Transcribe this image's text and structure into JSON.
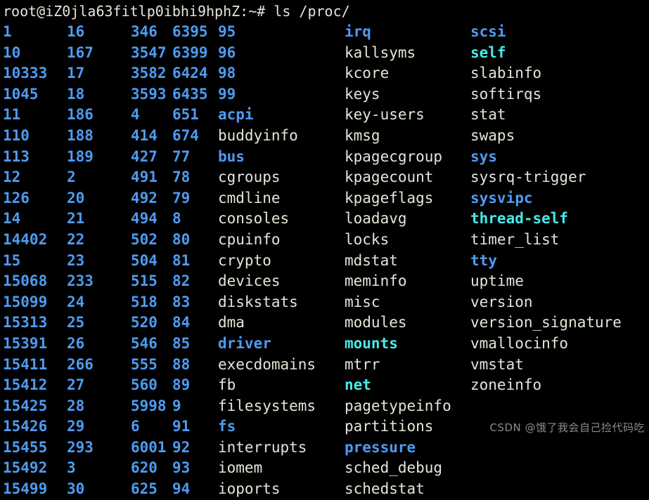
{
  "terminal": {
    "background_color": "#000000",
    "prompt": "root@iZ0jla63fitlp0ibhi9hphZ:~# ",
    "command": "ls /proc/",
    "colors": {
      "directory": "#4e9bf0",
      "file": "#e9e3d9",
      "symlink": "#4ae8e8"
    },
    "columns": [
      {
        "name": "column-1",
        "entries": [
          {
            "text": "1",
            "type": "dir"
          },
          {
            "text": "10",
            "type": "dir"
          },
          {
            "text": "10333",
            "type": "dir"
          },
          {
            "text": "1045",
            "type": "dir"
          },
          {
            "text": "11",
            "type": "dir"
          },
          {
            "text": "110",
            "type": "dir"
          },
          {
            "text": "113",
            "type": "dir"
          },
          {
            "text": "12",
            "type": "dir"
          },
          {
            "text": "126",
            "type": "dir"
          },
          {
            "text": "14",
            "type": "dir"
          },
          {
            "text": "14402",
            "type": "dir"
          },
          {
            "text": "15",
            "type": "dir"
          },
          {
            "text": "15068",
            "type": "dir"
          },
          {
            "text": "15099",
            "type": "dir"
          },
          {
            "text": "15313",
            "type": "dir"
          },
          {
            "text": "15391",
            "type": "dir"
          },
          {
            "text": "15411",
            "type": "dir"
          },
          {
            "text": "15412",
            "type": "dir"
          },
          {
            "text": "15425",
            "type": "dir"
          },
          {
            "text": "15426",
            "type": "dir"
          },
          {
            "text": "15455",
            "type": "dir"
          },
          {
            "text": "15492",
            "type": "dir"
          },
          {
            "text": "15499",
            "type": "dir"
          }
        ]
      },
      {
        "name": "column-2",
        "entries": [
          {
            "text": "16",
            "type": "dir"
          },
          {
            "text": "167",
            "type": "dir"
          },
          {
            "text": "17",
            "type": "dir"
          },
          {
            "text": "18",
            "type": "dir"
          },
          {
            "text": "186",
            "type": "dir"
          },
          {
            "text": "188",
            "type": "dir"
          },
          {
            "text": "189",
            "type": "dir"
          },
          {
            "text": "2",
            "type": "dir"
          },
          {
            "text": "20",
            "type": "dir"
          },
          {
            "text": "21",
            "type": "dir"
          },
          {
            "text": "22",
            "type": "dir"
          },
          {
            "text": "23",
            "type": "dir"
          },
          {
            "text": "233",
            "type": "dir"
          },
          {
            "text": "24",
            "type": "dir"
          },
          {
            "text": "25",
            "type": "dir"
          },
          {
            "text": "26",
            "type": "dir"
          },
          {
            "text": "266",
            "type": "dir"
          },
          {
            "text": "27",
            "type": "dir"
          },
          {
            "text": "28",
            "type": "dir"
          },
          {
            "text": "29",
            "type": "dir"
          },
          {
            "text": "293",
            "type": "dir"
          },
          {
            "text": "3",
            "type": "dir"
          },
          {
            "text": "30",
            "type": "dir"
          }
        ]
      },
      {
        "name": "column-3",
        "entries": [
          {
            "text": "346",
            "type": "dir"
          },
          {
            "text": "3547",
            "type": "dir"
          },
          {
            "text": "3582",
            "type": "dir"
          },
          {
            "text": "3593",
            "type": "dir"
          },
          {
            "text": "4",
            "type": "dir"
          },
          {
            "text": "414",
            "type": "dir"
          },
          {
            "text": "427",
            "type": "dir"
          },
          {
            "text": "491",
            "type": "dir"
          },
          {
            "text": "492",
            "type": "dir"
          },
          {
            "text": "494",
            "type": "dir"
          },
          {
            "text": "502",
            "type": "dir"
          },
          {
            "text": "504",
            "type": "dir"
          },
          {
            "text": "515",
            "type": "dir"
          },
          {
            "text": "518",
            "type": "dir"
          },
          {
            "text": "520",
            "type": "dir"
          },
          {
            "text": "546",
            "type": "dir"
          },
          {
            "text": "555",
            "type": "dir"
          },
          {
            "text": "560",
            "type": "dir"
          },
          {
            "text": "5998",
            "type": "dir"
          },
          {
            "text": "6",
            "type": "dir"
          },
          {
            "text": "6001",
            "type": "dir"
          },
          {
            "text": "620",
            "type": "dir"
          },
          {
            "text": "625",
            "type": "dir"
          }
        ]
      },
      {
        "name": "column-4",
        "entries": [
          {
            "text": "6395",
            "type": "dir"
          },
          {
            "text": "6399",
            "type": "dir"
          },
          {
            "text": "6424",
            "type": "dir"
          },
          {
            "text": "6435",
            "type": "dir"
          },
          {
            "text": "651",
            "type": "dir"
          },
          {
            "text": "674",
            "type": "dir"
          },
          {
            "text": "77",
            "type": "dir"
          },
          {
            "text": "78",
            "type": "dir"
          },
          {
            "text": "79",
            "type": "dir"
          },
          {
            "text": "8",
            "type": "dir"
          },
          {
            "text": "80",
            "type": "dir"
          },
          {
            "text": "81",
            "type": "dir"
          },
          {
            "text": "82",
            "type": "dir"
          },
          {
            "text": "83",
            "type": "dir"
          },
          {
            "text": "84",
            "type": "dir"
          },
          {
            "text": "85",
            "type": "dir"
          },
          {
            "text": "88",
            "type": "dir"
          },
          {
            "text": "89",
            "type": "dir"
          },
          {
            "text": "9",
            "type": "dir"
          },
          {
            "text": "91",
            "type": "dir"
          },
          {
            "text": "92",
            "type": "dir"
          },
          {
            "text": "93",
            "type": "dir"
          },
          {
            "text": "94",
            "type": "dir"
          }
        ]
      },
      {
        "name": "column-5",
        "entries": [
          {
            "text": "95",
            "type": "dir"
          },
          {
            "text": "96",
            "type": "dir"
          },
          {
            "text": "98",
            "type": "dir"
          },
          {
            "text": "99",
            "type": "dir"
          },
          {
            "text": "acpi",
            "type": "dir"
          },
          {
            "text": "buddyinfo",
            "type": "file"
          },
          {
            "text": "bus",
            "type": "dir"
          },
          {
            "text": "cgroups",
            "type": "file"
          },
          {
            "text": "cmdline",
            "type": "file"
          },
          {
            "text": "consoles",
            "type": "file"
          },
          {
            "text": "cpuinfo",
            "type": "file"
          },
          {
            "text": "crypto",
            "type": "file"
          },
          {
            "text": "devices",
            "type": "file"
          },
          {
            "text": "diskstats",
            "type": "file"
          },
          {
            "text": "dma",
            "type": "file"
          },
          {
            "text": "driver",
            "type": "dir"
          },
          {
            "text": "execdomains",
            "type": "file"
          },
          {
            "text": "fb",
            "type": "file"
          },
          {
            "text": "filesystems",
            "type": "file"
          },
          {
            "text": "fs",
            "type": "dir"
          },
          {
            "text": "interrupts",
            "type": "file"
          },
          {
            "text": "iomem",
            "type": "file"
          },
          {
            "text": "ioports",
            "type": "file"
          }
        ]
      },
      {
        "name": "column-6",
        "entries": [
          {
            "text": "irq",
            "type": "dir"
          },
          {
            "text": "kallsyms",
            "type": "file"
          },
          {
            "text": "kcore",
            "type": "file"
          },
          {
            "text": "keys",
            "type": "file"
          },
          {
            "text": "key-users",
            "type": "file"
          },
          {
            "text": "kmsg",
            "type": "file"
          },
          {
            "text": "kpagecgroup",
            "type": "file"
          },
          {
            "text": "kpagecount",
            "type": "file"
          },
          {
            "text": "kpageflags",
            "type": "file"
          },
          {
            "text": "loadavg",
            "type": "file"
          },
          {
            "text": "locks",
            "type": "file"
          },
          {
            "text": "mdstat",
            "type": "file"
          },
          {
            "text": "meminfo",
            "type": "file"
          },
          {
            "text": "misc",
            "type": "file"
          },
          {
            "text": "modules",
            "type": "file"
          },
          {
            "text": "mounts",
            "type": "link"
          },
          {
            "text": "mtrr",
            "type": "file"
          },
          {
            "text": "net",
            "type": "link"
          },
          {
            "text": "pagetypeinfo",
            "type": "file"
          },
          {
            "text": "partitions",
            "type": "file"
          },
          {
            "text": "pressure",
            "type": "dir"
          },
          {
            "text": "sched_debug",
            "type": "file"
          },
          {
            "text": "schedstat",
            "type": "file"
          }
        ]
      },
      {
        "name": "column-7",
        "entries": [
          {
            "text": "scsi",
            "type": "dir"
          },
          {
            "text": "self",
            "type": "link"
          },
          {
            "text": "slabinfo",
            "type": "file"
          },
          {
            "text": "softirqs",
            "type": "file"
          },
          {
            "text": "stat",
            "type": "file"
          },
          {
            "text": "swaps",
            "type": "file"
          },
          {
            "text": "sys",
            "type": "dir"
          },
          {
            "text": "sysrq-trigger",
            "type": "file"
          },
          {
            "text": "sysvipc",
            "type": "dir"
          },
          {
            "text": "thread-self",
            "type": "link"
          },
          {
            "text": "timer_list",
            "type": "file"
          },
          {
            "text": "tty",
            "type": "dir"
          },
          {
            "text": "uptime",
            "type": "file"
          },
          {
            "text": "version",
            "type": "file"
          },
          {
            "text": "version_signature",
            "type": "file"
          },
          {
            "text": "vmallocinfo",
            "type": "file"
          },
          {
            "text": "vmstat",
            "type": "file"
          },
          {
            "text": "zoneinfo",
            "type": "file"
          },
          {
            "text": "",
            "type": "empty"
          },
          {
            "text": "",
            "type": "empty"
          },
          {
            "text": "",
            "type": "empty"
          },
          {
            "text": "",
            "type": "empty"
          },
          {
            "text": "",
            "type": "empty"
          }
        ]
      }
    ]
  },
  "watermark": {
    "text": "CSDN @饿了我会自己捡代码吃"
  }
}
